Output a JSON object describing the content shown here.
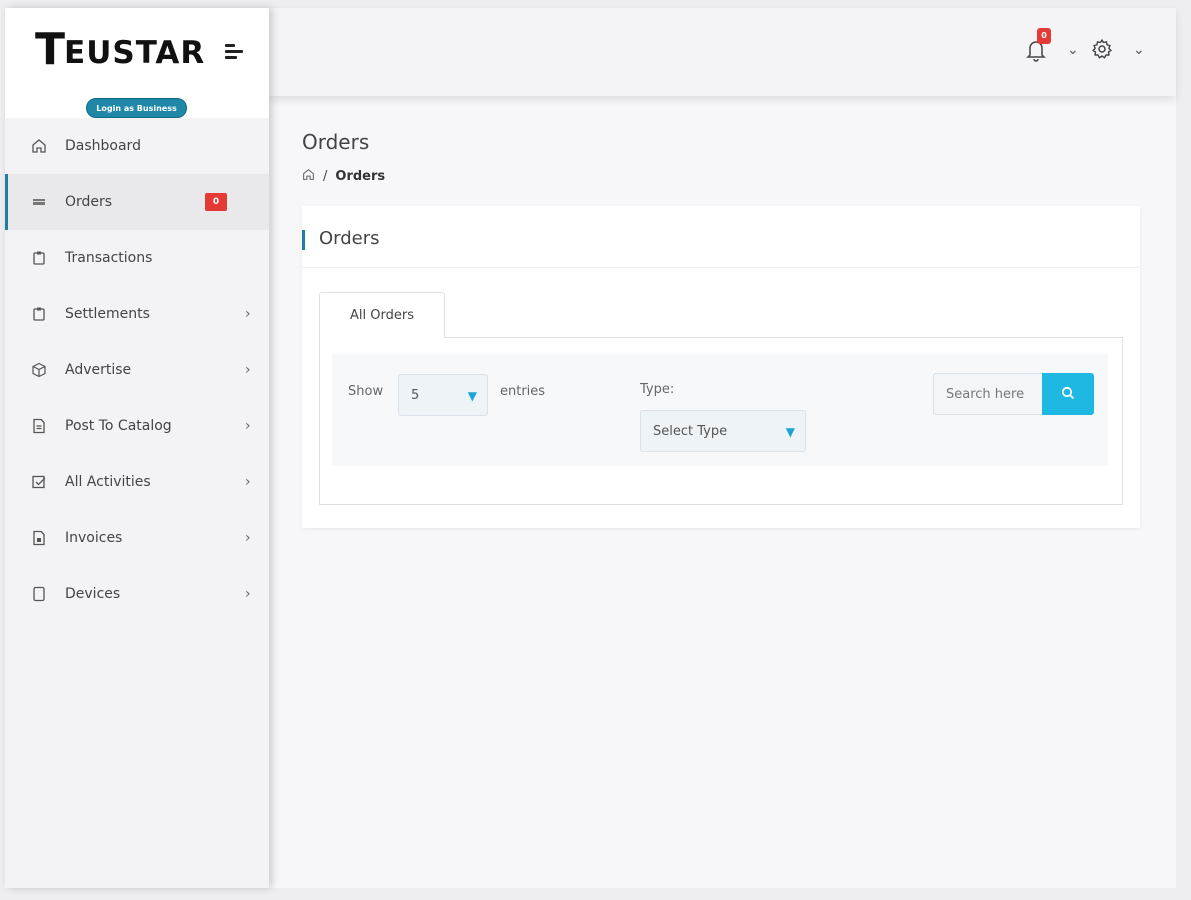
{
  "brand": {
    "logo_first_letter": "T",
    "logo_rest": "EUSTAR",
    "login_pill": "Login as Business"
  },
  "sidebar": {
    "items": [
      {
        "label": "Dashboard",
        "icon": "home-icon",
        "chevron": false
      },
      {
        "label": "Orders",
        "icon": "orders-icon",
        "badge": "0",
        "active": true
      },
      {
        "label": "Transactions",
        "icon": "clipboard-icon",
        "chevron": false
      },
      {
        "label": "Settlements",
        "icon": "clipboard-icon",
        "chevron": true
      },
      {
        "label": "Advertise",
        "icon": "box-icon",
        "chevron": true
      },
      {
        "label": "Post To Catalog",
        "icon": "document-icon",
        "chevron": true
      },
      {
        "label": "All Activities",
        "icon": "checkbox-icon",
        "chevron": true
      },
      {
        "label": "Invoices",
        "icon": "invoice-icon",
        "chevron": true
      },
      {
        "label": "Devices",
        "icon": "tablet-icon",
        "chevron": true
      }
    ],
    "chevron_glyph": "›"
  },
  "header": {
    "notification_count": "0",
    "dropdown_glyph": "⌄"
  },
  "page": {
    "title": "Orders",
    "breadcrumb_separator": "/",
    "breadcrumb_current": "Orders"
  },
  "card": {
    "title": "Orders",
    "tab_label": "All Orders",
    "show_label": "Show",
    "show_value": "5",
    "entries_label": "entries",
    "type_label": "Type:",
    "type_placeholder": "Select Type",
    "search_placeholder": "Search here"
  },
  "colors": {
    "accent": "#1f7fa0",
    "search_button": "#1fb8e3",
    "badge": "#e53935"
  }
}
